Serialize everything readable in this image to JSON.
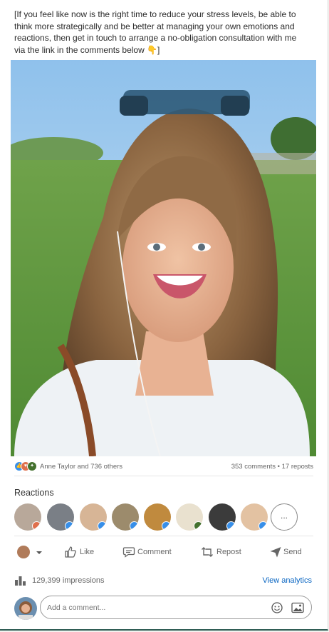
{
  "post": {
    "text": "[If you feel like now is the right time to reduce your stress levels, be able to think more strategically and be better at managing your own emotions and reactions, then get in touch to arrange a no-obligation consultation with me via the link in the comments below 👇]"
  },
  "social": {
    "reactors": "Anne Taylor and 736 others",
    "counts": "353 comments • 17 reposts"
  },
  "reactions": {
    "title": "Reactions",
    "more": "..."
  },
  "actions": {
    "like": "Like",
    "comment": "Comment",
    "repost": "Repost",
    "send": "Send"
  },
  "impressions": {
    "text": "129,399 impressions",
    "analytics": "View analytics"
  },
  "comment_box": {
    "placeholder": "Add a comment..."
  },
  "colors": {
    "link_blue": "#0a66c2",
    "like_blue": "#378fe9",
    "love_red": "#df704d",
    "celebrate_green": "#44712e"
  }
}
